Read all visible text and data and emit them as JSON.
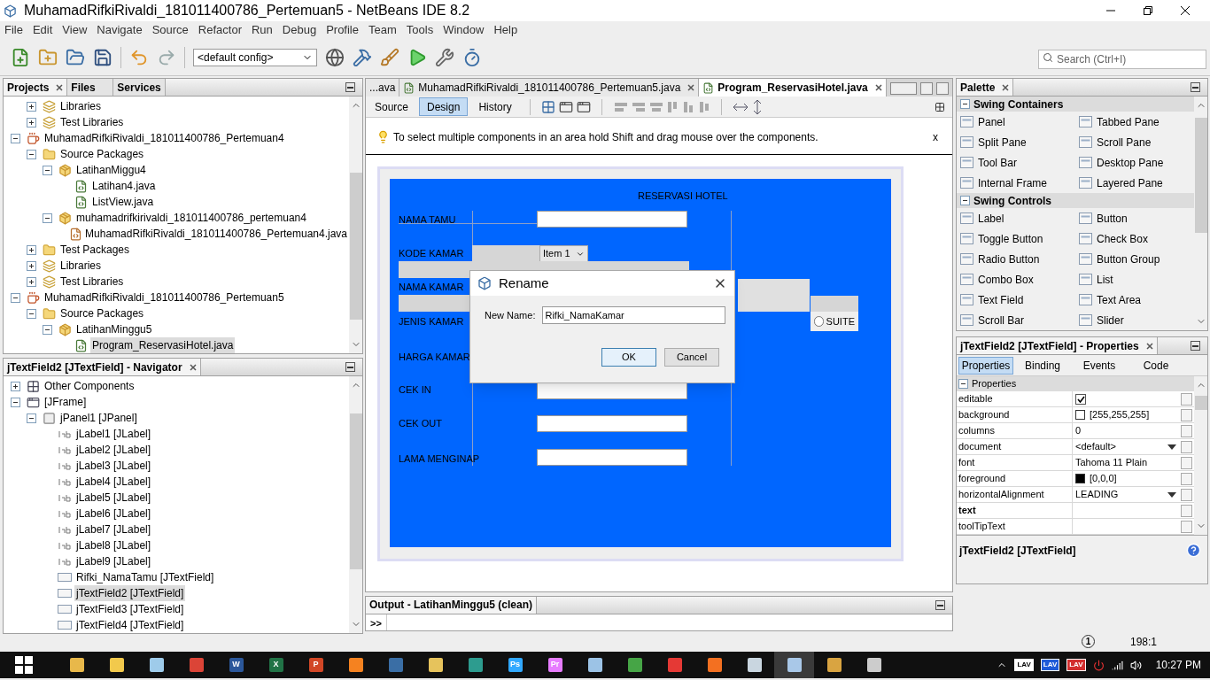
{
  "window": {
    "title": "MuhamadRifkiRivaldi_181011400786_Pertemuan5 - NetBeans IDE 8.2"
  },
  "menu": [
    "File",
    "Edit",
    "View",
    "Navigate",
    "Source",
    "Refactor",
    "Run",
    "Debug",
    "Profile",
    "Team",
    "Tools",
    "Window",
    "Help"
  ],
  "toolbar": {
    "config": "<default config>",
    "search": {
      "placeholder": "Search (Ctrl+I)"
    }
  },
  "projects": {
    "tabs": [
      {
        "label": "Projects",
        "selected": true
      },
      {
        "label": "Files",
        "selected": false
      },
      {
        "label": "Services",
        "selected": false
      }
    ],
    "tree": [
      {
        "children": [
          {
            "label": "Libraries",
            "kind": "libraries",
            "expanded": false,
            "selected": false
          },
          {
            "label": "Test Libraries",
            "kind": "libraries",
            "expanded": false,
            "selected": false
          }
        ]
      },
      {
        "label": "MuhamadRifkiRivaldi_181011400786_Pertemuan4",
        "kind": "project",
        "expanded": true,
        "selected": false,
        "children": [
          {
            "label": "Source Packages",
            "kind": "folder",
            "expanded": true,
            "selected": false,
            "children": [
              {
                "label": "LatihanMiggu4",
                "kind": "package",
                "expanded": true,
                "selected": false,
                "children": [
                  {
                    "label": "Latihan4.java",
                    "kind": "java",
                    "selected": false
                  },
                  {
                    "label": "ListView.java",
                    "kind": "java",
                    "selected": false
                  }
                ]
              },
              {
                "label": "muhamadrifkirivaldi_181011400786_pertemuan4",
                "kind": "package",
                "expanded": true,
                "selected": false,
                "children": [
                  {
                    "label": "MuhamadRifkiRivaldi_181011400786_Pertemuan4.java",
                    "kind": "main",
                    "selected": false
                  }
                ]
              }
            ]
          },
          {
            "label": "Test Packages",
            "kind": "folder",
            "expanded": false,
            "selected": false
          },
          {
            "label": "Libraries",
            "kind": "libraries",
            "expanded": false,
            "selected": false
          },
          {
            "label": "Test Libraries",
            "kind": "libraries",
            "expanded": false,
            "selected": false
          }
        ]
      },
      {
        "label": "MuhamadRifkiRivaldi_181011400786_Pertemuan5",
        "kind": "project",
        "expanded": true,
        "selected": false,
        "children": [
          {
            "label": "Source Packages",
            "kind": "folder",
            "expanded": true,
            "selected": false,
            "children": [
              {
                "label": "LatihanMinggu5",
                "kind": "package",
                "expanded": true,
                "selected": false,
                "children": [
                  {
                    "label": "Program_ReservasiHotel.java",
                    "kind": "java",
                    "selected": true
                  }
                ]
              }
            ]
          }
        ]
      }
    ]
  },
  "navigator": {
    "title": "jTextField2 [JTextField] - Navigator",
    "tree": [
      {
        "label": "Other Components",
        "kind": "other",
        "expanded": false,
        "selected": false
      },
      {
        "label": "[JFrame]",
        "kind": "frame",
        "expanded": true,
        "selected": false,
        "children": [
          {
            "label": "jPanel1 [JPanel]",
            "kind": "panel",
            "expanded": true,
            "selected": false,
            "children": [
              {
                "label": "jLabel1 [JLabel]",
                "kind": "label",
                "selected": false
              },
              {
                "label": "jLabel2 [JLabel]",
                "kind": "label",
                "selected": false
              },
              {
                "label": "jLabel3 [JLabel]",
                "kind": "label",
                "selected": false
              },
              {
                "label": "jLabel4 [JLabel]",
                "kind": "label",
                "selected": false
              },
              {
                "label": "jLabel5 [JLabel]",
                "kind": "label",
                "selected": false
              },
              {
                "label": "jLabel6 [JLabel]",
                "kind": "label",
                "selected": false
              },
              {
                "label": "jLabel7 [JLabel]",
                "kind": "label",
                "selected": false
              },
              {
                "label": "jLabel8 [JLabel]",
                "kind": "label",
                "selected": false
              },
              {
                "label": "jLabel9 [JLabel]",
                "kind": "label",
                "selected": false
              },
              {
                "label": "Rifki_NamaTamu [JTextField]",
                "kind": "textfield",
                "selected": false
              },
              {
                "label": "jTextField2 [JTextField]",
                "kind": "textfield",
                "selected": true
              },
              {
                "label": "jTextField3 [JTextField]",
                "kind": "textfield",
                "selected": false
              },
              {
                "label": "jTextField4 [JTextField]",
                "kind": "textfield",
                "selected": false
              }
            ]
          }
        ]
      }
    ]
  },
  "editor": {
    "tabs": [
      {
        "label": "...ava",
        "selected": false
      },
      {
        "label": "MuhamadRifkiRivaldi_181011400786_Pertemuan5.java",
        "selected": false
      },
      {
        "label": "Program_ReservasiHotel.java",
        "selected": true
      }
    ],
    "views": [
      {
        "label": "Source",
        "selected": false
      },
      {
        "label": "Design",
        "selected": true
      },
      {
        "label": "History",
        "selected": false
      }
    ],
    "hint": "To select multiple components in an area hold Shift and drag mouse over the components.",
    "hint_close": "x"
  },
  "form": {
    "title": "RESERVASI HOTEL",
    "labels": [
      "NAMA TAMU",
      "KODE KAMAR",
      "NAMA KAMAR",
      "JENIS KAMAR",
      "HARGA KAMAR",
      "CEK IN",
      "CEK OUT",
      "LAMA MENGINAP"
    ],
    "combo": "Item 1",
    "radio": {
      "label": "SUITE",
      "checked": false
    }
  },
  "dialog": {
    "title": "Rename",
    "field_label": "New Name:",
    "value": "Rifki_NamaKamar",
    "buttons": [
      {
        "label": "OK",
        "selected": true
      },
      {
        "label": "Cancel",
        "selected": false
      }
    ]
  },
  "output": {
    "title": "Output - LatihanMinggu5 (clean)",
    "button": ">>"
  },
  "palette": {
    "title": "Palette",
    "sections": [
      {
        "title": "Swing Containers",
        "expanded": true,
        "items": [
          "Panel",
          "Tabbed Pane",
          "Split Pane",
          "Scroll Pane",
          "Tool Bar",
          "Desktop Pane",
          "Internal Frame",
          "Layered Pane"
        ]
      },
      {
        "title": "Swing Controls",
        "expanded": true,
        "items": [
          "Label",
          "Button",
          "Toggle Button",
          "Check Box",
          "Radio Button",
          "Button Group",
          "Combo Box",
          "List",
          "Text Field",
          "Text Area",
          "Scroll Bar",
          "Slider"
        ]
      }
    ]
  },
  "properties": {
    "title": "jTextField2 [JTextField] - Properties",
    "tabs": [
      {
        "label": "Properties",
        "selected": true
      },
      {
        "label": "Binding",
        "selected": false
      },
      {
        "label": "Events",
        "selected": false
      },
      {
        "label": "Code",
        "selected": false
      }
    ],
    "section": "Properties",
    "rows": [
      {
        "name": "editable",
        "kind": "checkbox",
        "checked": true,
        "bold": false
      },
      {
        "name": "background",
        "kind": "color",
        "color": "#ffffff",
        "value": "[255,255,255]",
        "bold": false
      },
      {
        "name": "columns",
        "kind": "text",
        "value": "0",
        "bold": false
      },
      {
        "name": "document",
        "kind": "dropdown",
        "value": "<default>",
        "bold": false
      },
      {
        "name": "font",
        "kind": "text",
        "value": "Tahoma 11 Plain",
        "bold": false
      },
      {
        "name": "foreground",
        "kind": "color",
        "color": "#000000",
        "value": "[0,0,0]",
        "bold": false
      },
      {
        "name": "horizontalAlignment",
        "kind": "dropdown",
        "value": "LEADING",
        "bold": false
      },
      {
        "name": "text",
        "kind": "text",
        "bold": true
      },
      {
        "name": "toolTipText",
        "kind": "text",
        "bold": false
      }
    ],
    "footer": "jTextField2 [JTextField]"
  },
  "status": {
    "notifications": "1",
    "position": "198:1"
  },
  "taskbar": {
    "apps": [
      {
        "color": "#e8b84a",
        "selected": false
      },
      {
        "color": "#f2c94c",
        "selected": false
      },
      {
        "color": "#9ecbea",
        "selected": false
      },
      {
        "color": "#db4437",
        "selected": false
      },
      {
        "color": "#2b579a",
        "text": "W",
        "selected": false
      },
      {
        "color": "#217346",
        "text": "X",
        "selected": false
      },
      {
        "color": "#d24726",
        "text": "P",
        "selected": false
      },
      {
        "color": "#f58220",
        "selected": false
      },
      {
        "color": "#3a6ea5",
        "selected": false
      },
      {
        "color": "#e6c35c",
        "selected": false
      },
      {
        "color": "#2d9c8f",
        "selected": false
      },
      {
        "color": "#31a8ff",
        "text": "Ps",
        "selected": false
      },
      {
        "color": "#e77cff",
        "text": "Pr",
        "selected": false
      },
      {
        "color": "#9cc3e6",
        "selected": false
      },
      {
        "color": "#46a546",
        "selected": false
      },
      {
        "color": "#e53935",
        "selected": false
      },
      {
        "color": "#f37021",
        "selected": false
      },
      {
        "color": "#c9d6e0",
        "selected": false
      },
      {
        "color": "#a9c8e8",
        "selected": true
      },
      {
        "color": "#d9a441",
        "selected": false
      },
      {
        "color": "#cccccc",
        "selected": false
      }
    ],
    "tray": [
      {
        "text": "LAV",
        "color": "#ffffff"
      },
      {
        "text": "LAV",
        "color": "#1e5bd8"
      },
      {
        "text": "LAV",
        "color": "#d32f2f"
      }
    ],
    "clock": "10:27 PM"
  }
}
